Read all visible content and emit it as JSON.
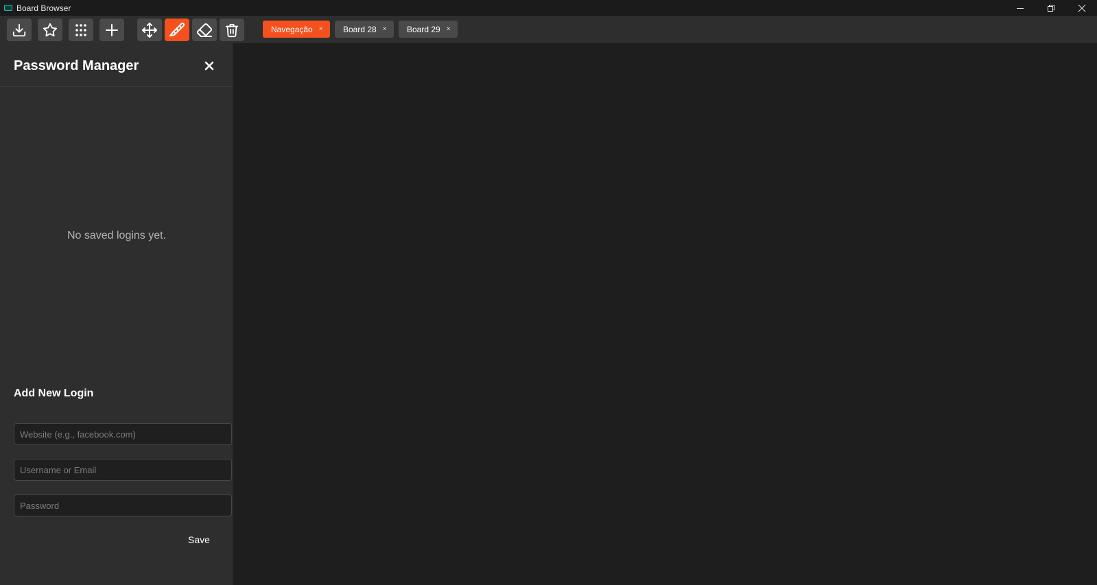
{
  "window": {
    "title": "Board Browser",
    "controls": [
      "minimize-icon",
      "restore-icon",
      "close-icon"
    ]
  },
  "toolbar": {
    "buttons": [
      {
        "icon": "download-icon",
        "active": false
      },
      {
        "icon": "star-icon",
        "active": false
      },
      {
        "icon": "grid-icon",
        "active": false
      },
      {
        "icon": "plus-icon",
        "active": false
      },
      {
        "icon": "move-icon",
        "active": false
      },
      {
        "icon": "brush-icon",
        "active": true
      },
      {
        "icon": "eraser-icon",
        "active": false
      },
      {
        "icon": "trash-icon",
        "active": false
      }
    ],
    "tabs": [
      {
        "label": "Navegação",
        "close": "×",
        "active": true
      },
      {
        "label": "Board 28",
        "close": "×",
        "active": false
      },
      {
        "label": "Board 29",
        "close": "×",
        "active": false
      }
    ]
  },
  "panel": {
    "title": "Password Manager",
    "empty_message": "No saved logins yet.",
    "add_title": "Add New Login",
    "website_placeholder": "Website (e.g., facebook.com)",
    "username_placeholder": "Username or Email",
    "password_placeholder": "Password",
    "save_label": "Save"
  },
  "colors": {
    "accent": "#f4511e",
    "toolbar_bg": "#2e2e2e",
    "button_bg": "#4a4a4a",
    "content_bg": "#1e1e1e"
  }
}
